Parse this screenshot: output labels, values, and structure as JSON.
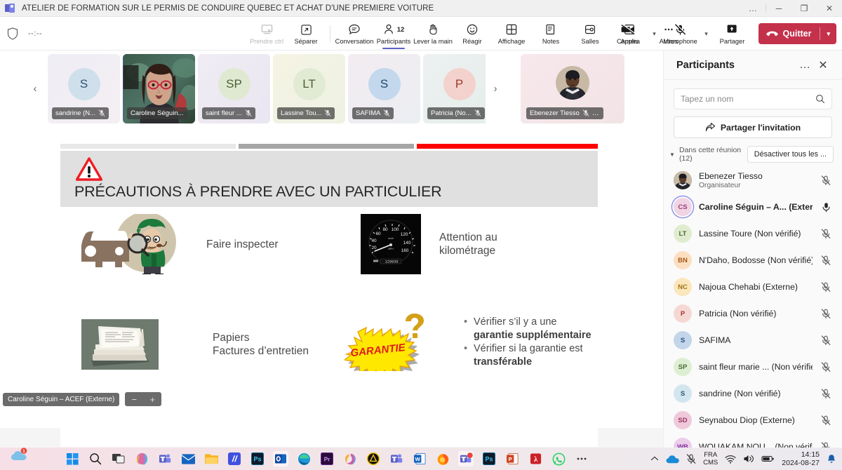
{
  "window": {
    "title": "ATELIER DE FORMATION SUR LE PERMIS DE CONDUIRE QUEBEC ET ACHAT D'UNE PREMIERE VOITURE",
    "more_label": "…",
    "minimize_label": "─",
    "restore_label": "❐",
    "close_label": "✕"
  },
  "toolbar": {
    "timer": "--:--",
    "items": [
      {
        "label": "Prendre ctrl",
        "icon": "give-control-icon",
        "state": "disabled"
      },
      {
        "label": "Séparer",
        "icon": "pop-out-icon",
        "state": "normal"
      },
      {
        "label": "Conversation",
        "icon": "chat-icon",
        "state": "normal"
      },
      {
        "label": "Participants",
        "icon": "people-icon",
        "state": "active",
        "count": "12"
      },
      {
        "label": "Lever la main",
        "icon": "raise-hand-icon",
        "state": "normal"
      },
      {
        "label": "Réagir",
        "icon": "emoji-icon",
        "state": "normal"
      },
      {
        "label": "Affichage",
        "icon": "layout-grid-icon",
        "state": "normal"
      },
      {
        "label": "Notes",
        "icon": "notes-icon",
        "state": "normal"
      },
      {
        "label": "Salles",
        "icon": "breakout-rooms-icon",
        "state": "normal"
      },
      {
        "label": "Applis",
        "icon": "apps-plus-icon",
        "state": "normal"
      },
      {
        "label": "Autres",
        "icon": "ellipsis-icon",
        "state": "normal"
      }
    ],
    "camera_label": "Caméra",
    "microphone_label": "Microphone",
    "share_label": "Partager",
    "leave_label": "Quitter",
    "leave_color": "#c4314b"
  },
  "filmstrip": {
    "prev_label": "‹",
    "next_label": "›",
    "tiles": [
      {
        "name": "sandrine (N...",
        "initials": "S",
        "muted": true,
        "avatar_bg": "#cfe0ec",
        "avatar_fg": "#2e5272",
        "tile_bg": "linear-gradient(135deg,#efeef5,#f3eef2)",
        "video": false
      },
      {
        "name": "Caroline Séguin...",
        "initials": "CS",
        "muted": false,
        "avatar_bg": "#ecd5e3",
        "avatar_fg": "#8a3c6e",
        "tile_bg": "#1d2b1c",
        "video": true,
        "active": true
      },
      {
        "name": "saint fleur ...",
        "initials": "SP",
        "muted": true,
        "avatar_bg": "#dfe9d2",
        "avatar_fg": "#4a5f33",
        "tile_bg": "linear-gradient(135deg,#f0ecf3,#eae6f2)",
        "video": false
      },
      {
        "name": "Lassine Tou...",
        "initials": "LT",
        "muted": true,
        "avatar_bg": "#e1ebd4",
        "avatar_fg": "#4a5f33",
        "tile_bg": "linear-gradient(135deg,#f5f3e4,#eef2e3)",
        "video": false
      },
      {
        "name": "SAFIMA",
        "initials": "S",
        "muted": true,
        "avatar_bg": "#c3d8ec",
        "avatar_fg": "#23456b",
        "tile_bg": "linear-gradient(135deg,#f2ecf0,#eceef3)",
        "video": false
      },
      {
        "name": "Patricia (No...",
        "initials": "P",
        "muted": true,
        "avatar_bg": "#f3d2cd",
        "avatar_fg": "#9b3a2a",
        "tile_bg": "linear-gradient(135deg,#edf0f1,#e4eeea)",
        "video": false
      },
      {
        "name": "Ebenezer Tiesso",
        "initials": "ET",
        "muted": true,
        "avatar_bg": "#8a7c6d",
        "avatar_fg": "#ffffff",
        "tile_bg": "linear-gradient(135deg,#f7e8ec,#f2e3e6)",
        "video": false,
        "photo": true,
        "overflow": "…",
        "wide": true
      }
    ]
  },
  "slide": {
    "title": "PRÉCAUTIONS À PRENDRE AVEC UN PARTICULIER",
    "accent_color": "#ff0000",
    "items": [
      {
        "caption": "Faire inspecter",
        "image": "car-inspector-image"
      },
      {
        "caption_line1": "Attention au",
        "caption_line2": "kilométrage",
        "image": "odometer-image"
      },
      {
        "caption_line1": "Papiers",
        "caption_line2": "Factures d’entretien",
        "image": "papers-stack-image"
      }
    ],
    "warranty": {
      "image_label": "GARANTIE",
      "bullets": [
        {
          "plain": "Vérifier s’il y a une ",
          "bold": "garantie supplémentaire"
        },
        {
          "plain": "Vérifier si la garantie est ",
          "bold": "transférable"
        }
      ]
    }
  },
  "presenter": {
    "pill": "Caroline Séguin – ACEF (Externe)",
    "zoom_out": "−",
    "zoom_in": "+"
  },
  "panel": {
    "title": "Participants",
    "more_label": "…",
    "close_label": "✕",
    "search_placeholder": "Tapez un nom",
    "share_invite_label": "Partager l'invitation",
    "section_label_line1": "Dans cette réunion",
    "section_label_line2": "(12)",
    "mute_all_label": "Désactiver tous les ...",
    "participants": [
      {
        "name": "Ebenezer Tiesso",
        "sub": "Organisateur",
        "initials": "ET",
        "bg": "#8a7c6d",
        "fg": "#ffffff",
        "muted": true,
        "photo": true
      },
      {
        "name": "Caroline Séguin – A...  (Externe)",
        "initials": "CS",
        "bg": "#f0d4e4",
        "fg": "#9b3f77",
        "muted": false,
        "ring": true,
        "bold": true
      },
      {
        "name": "Lassine Toure (Non vérifié)",
        "initials": "LT",
        "bg": "#dfeccf",
        "fg": "#4e6b31",
        "muted": true
      },
      {
        "name": "N'Daho, Bodosse (Non vérifié)",
        "initials": "BN",
        "bg": "#fbdfc0",
        "fg": "#a6571c",
        "muted": true
      },
      {
        "name": "Najoua Chehabi (Externe)",
        "initials": "NC",
        "bg": "#fbe6bd",
        "fg": "#a07314",
        "muted": true
      },
      {
        "name": "Patricia (Non vérifié)",
        "initials": "P",
        "bg": "#f5d8d4",
        "fg": "#a4392c",
        "muted": true
      },
      {
        "name": "SAFIMA",
        "initials": "S",
        "bg": "#c3d5ea",
        "fg": "#27517d",
        "muted": true
      },
      {
        "name": "saint fleur marie ...  (Non vérifié)",
        "initials": "SP",
        "bg": "#ddefd2",
        "fg": "#4c6b35",
        "muted": true
      },
      {
        "name": "sandrine (Non vérifié)",
        "initials": "S",
        "bg": "#d3e6ef",
        "fg": "#2a5770",
        "muted": true
      },
      {
        "name": "Seynabou Diop (Externe)",
        "initials": "SD",
        "bg": "#efc9da",
        "fg": "#9c3360",
        "muted": true
      },
      {
        "name": "WOUAKAM NOU... (Non vérifié)",
        "initials": "WB",
        "bg": "#eccdeb",
        "fg": "#84329c",
        "muted": true
      }
    ]
  },
  "taskbar": {
    "cloud_badge": "1",
    "apps": [
      {
        "name": "start-button-icon"
      },
      {
        "name": "search-icon"
      },
      {
        "name": "task-view-icon"
      },
      {
        "name": "copilot-icon"
      },
      {
        "name": "teams-icon"
      },
      {
        "name": "mail-icon"
      },
      {
        "name": "file-explorer-icon"
      },
      {
        "name": "app-blue-icon"
      },
      {
        "name": "photoshop-icon"
      },
      {
        "name": "outlook-icon"
      },
      {
        "name": "edge-icon"
      },
      {
        "name": "premiere-pro-icon"
      },
      {
        "name": "office-icon"
      },
      {
        "name": "avast-icon"
      },
      {
        "name": "teams-classic-icon"
      },
      {
        "name": "word-icon"
      },
      {
        "name": "firefox-icon"
      },
      {
        "name": "teams-notification-icon"
      },
      {
        "name": "photoshop-2-icon"
      },
      {
        "name": "powerpoint-icon"
      },
      {
        "name": "acrobat-icon"
      },
      {
        "name": "whatsapp-icon"
      },
      {
        "name": "taskbar-overflow-icon"
      }
    ],
    "tray": {
      "chevron": "˄",
      "lang_line1": "FRA",
      "lang_line2": "CMS",
      "time": "14:15",
      "date": "2024-08-27"
    }
  }
}
